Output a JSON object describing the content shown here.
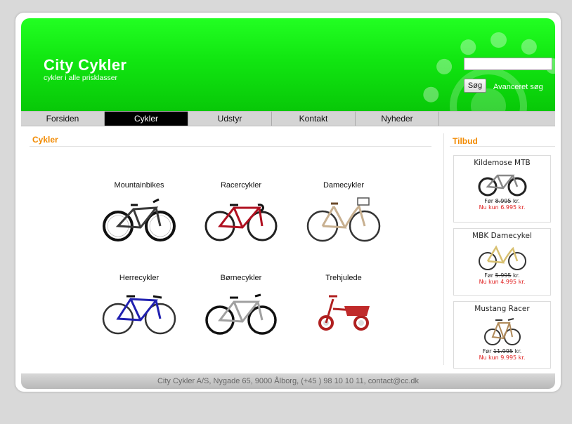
{
  "header": {
    "site_title": "City Cykler",
    "tagline": "cykler i alle prisklasser",
    "search_placeholder": "",
    "search_button": "Søg",
    "advanced_link": "Avanceret søg"
  },
  "nav": {
    "items": [
      "Forsiden",
      "Cykler",
      "Udstyr",
      "Kontakt",
      "Nyheder",
      ""
    ],
    "active": "Cykler"
  },
  "main": {
    "title": "Cykler",
    "categories": [
      {
        "label": "Mountainbikes",
        "icon": "mountainbike-icon",
        "frame": "#3a3a3a"
      },
      {
        "label": "Racercykler",
        "icon": "racer-bike-icon",
        "frame": "#b01020"
      },
      {
        "label": "Damecykler",
        "icon": "ladies-bike-icon",
        "frame": "#c8b090"
      },
      {
        "label": "Herrecykler",
        "icon": "mens-bike-icon",
        "frame": "#2020b0"
      },
      {
        "label": "Børnecykler",
        "icon": "kids-bike-icon",
        "frame": "#a0a0a0"
      },
      {
        "label": "Trehjulede",
        "icon": "tricycle-icon",
        "frame": "#b02020"
      }
    ]
  },
  "sidebar": {
    "title": "Tilbud",
    "offers": [
      {
        "name": "Kildemose MTB",
        "before_label": "Før",
        "before_price": "8.995",
        "before_unit": "kr.",
        "now": "Nu kun 6.995 kr."
      },
      {
        "name": "MBK Damecykel",
        "before_label": "Før",
        "before_price": "5.995",
        "before_unit": "kr.",
        "now": "Nu kun 4.995 kr."
      },
      {
        "name": "Mustang Racer",
        "before_label": "Før",
        "before_price": "11.995",
        "before_unit": "kr.",
        "now": "Nu kun 9.995 kr."
      }
    ]
  },
  "footer": {
    "text": "City Cykler A/S, Nygade 65, 9000 Ålborg, (+45 ) 98 10 10 11, contact@cc.dk"
  },
  "colors": {
    "header_green": "#11e611",
    "accent_orange": "#f28a00",
    "offer_red": "#e02020"
  }
}
